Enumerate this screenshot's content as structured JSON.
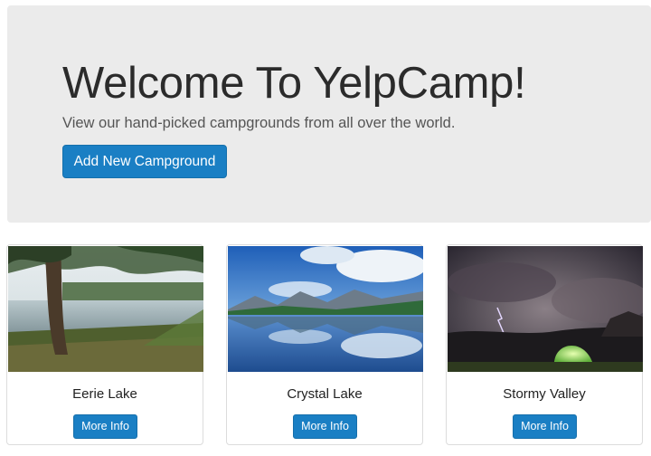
{
  "jumbotron": {
    "title": "Welcome To YelpCamp!",
    "lead": "View our hand-picked campgrounds from all over the world.",
    "add_button_label": "Add New Campground"
  },
  "campgrounds": [
    {
      "name": "Eerie Lake",
      "button_label": "More Info",
      "image": "lake-forest-image"
    },
    {
      "name": "Crystal Lake",
      "button_label": "More Info",
      "image": "mountain-lake-image"
    },
    {
      "name": "Stormy Valley",
      "button_label": "More Info",
      "image": "storm-tent-image"
    }
  ],
  "colors": {
    "primary": "#1a7fc4",
    "jumbotron_bg": "#ebebeb"
  }
}
